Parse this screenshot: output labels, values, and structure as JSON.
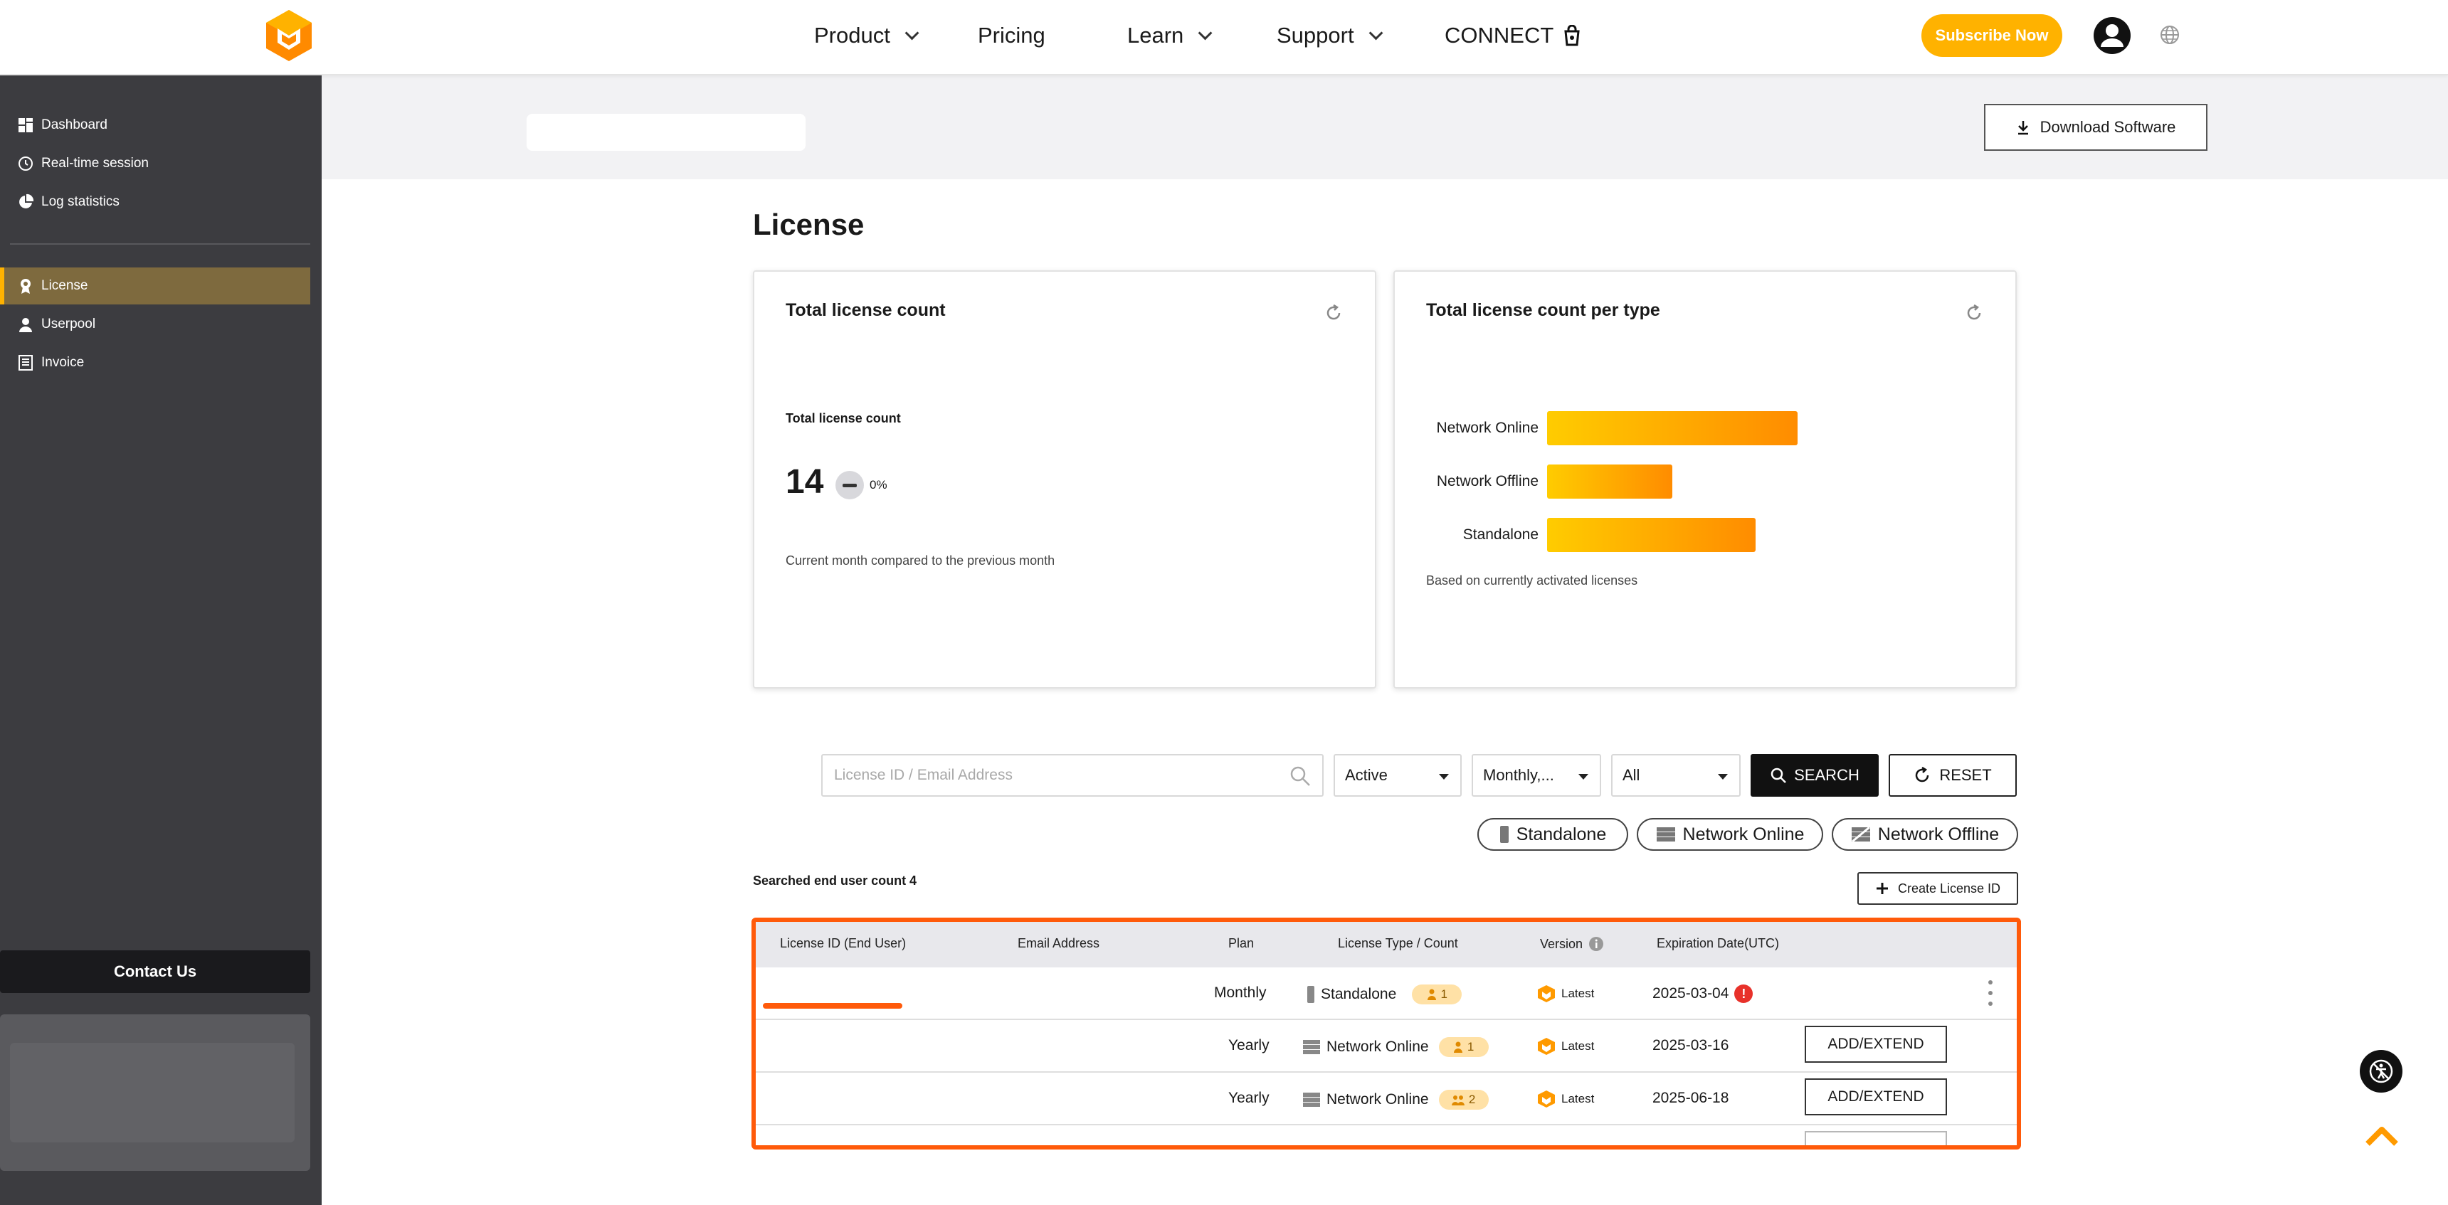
{
  "nav": {
    "items": [
      {
        "label": "Product",
        "dropdown": true
      },
      {
        "label": "Pricing",
        "dropdown": false
      },
      {
        "label": "Learn",
        "dropdown": true
      },
      {
        "label": "Support",
        "dropdown": true
      },
      {
        "label": "CONNECT",
        "dropdown": false
      }
    ],
    "subscribe_label": "Subscribe Now"
  },
  "sidebar": {
    "items": [
      {
        "label": "Dashboard",
        "icon": "dashboard-icon"
      },
      {
        "label": "Real-time session",
        "icon": "clock-icon"
      },
      {
        "label": "Log statistics",
        "icon": "pie-chart-icon"
      },
      {
        "label": "License",
        "icon": "license-icon",
        "active": true
      },
      {
        "label": "Userpool",
        "icon": "user-icon"
      },
      {
        "label": "Invoice",
        "icon": "invoice-icon"
      }
    ],
    "contact_label": "Contact Us"
  },
  "header": {
    "download_label": "Download Software"
  },
  "page": {
    "title": "License"
  },
  "card_total": {
    "title": "Total license count",
    "label": "Total license count",
    "value": "14",
    "change": "0%",
    "note": "Current month compared to the previous month"
  },
  "card_type": {
    "title": "Total license count per type",
    "note": "Based on currently activated licenses"
  },
  "chart_data": {
    "type": "bar",
    "orientation": "horizontal",
    "title": "Total license count per type",
    "categories": [
      "Network Online",
      "Network Offline",
      "Standalone"
    ],
    "values": [
      6,
      3,
      5
    ],
    "xlim": [
      0,
      12
    ],
    "grid": false,
    "colors": [
      "#ffcc00",
      "#ff8c00"
    ]
  },
  "filters": {
    "search_placeholder": "License ID / Email Address",
    "status": "Active",
    "plan": "Monthly,...",
    "type": "All",
    "search_label": "SEARCH",
    "reset_label": "RESET",
    "chips": [
      "Standalone",
      "Network Online",
      "Network Offline"
    ]
  },
  "results": {
    "count_label": "Searched end user count 4",
    "create_label": "Create License ID"
  },
  "table": {
    "columns": [
      "License ID (End User)",
      "Email Address",
      "Plan",
      "License Type / Count",
      "Version",
      "Expiration Date(UTC)"
    ],
    "rows": [
      {
        "plan": "Monthly",
        "type": "Standalone",
        "type_icon": "standalone-icon",
        "count": "1",
        "count_icon": "single-user-icon",
        "version": "Latest",
        "expiration": "2025-03-04",
        "alert": "!",
        "action": ""
      },
      {
        "plan": "Yearly",
        "type": "Network Online",
        "type_icon": "server-icon",
        "count": "1",
        "count_icon": "single-user-icon",
        "version": "Latest",
        "expiration": "2025-03-16",
        "action": "ADD/EXTEND"
      },
      {
        "plan": "Yearly",
        "type": "Network Online",
        "type_icon": "server-icon",
        "count": "2",
        "count_icon": "multi-user-icon",
        "version": "Latest",
        "expiration": "2025-06-18",
        "action": "ADD/EXTEND"
      }
    ]
  },
  "colors": {
    "accent": "#ffb200",
    "highlight_frame": "#ff5a0a",
    "sidebar_bg": "#3c3c40",
    "sidebar_active": "#7e6a3e"
  }
}
